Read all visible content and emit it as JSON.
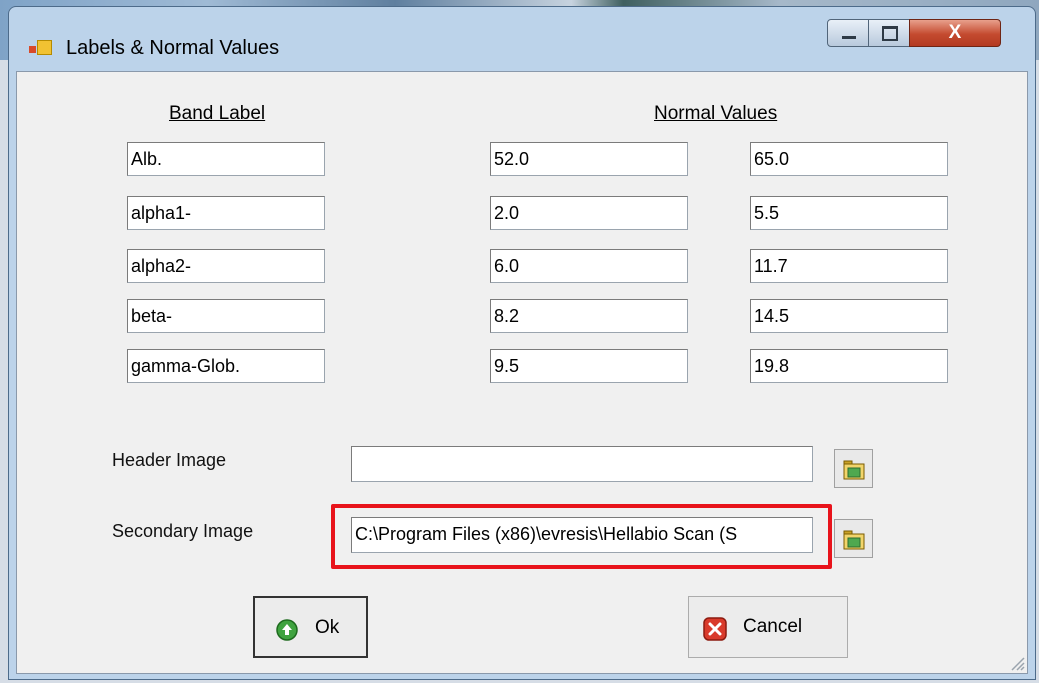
{
  "window": {
    "title": "Labels & Normal Values"
  },
  "titlebar": {
    "close_glyph": "X"
  },
  "headers": {
    "band_label": "Band Label",
    "normal_values": "Normal Values"
  },
  "bands": [
    {
      "label": "Alb.",
      "low": "52.0",
      "high": "65.0"
    },
    {
      "label": "alpha1-",
      "low": "2.0",
      "high": "5.5"
    },
    {
      "label": "alpha2-",
      "low": "6.0",
      "high": "11.7"
    },
    {
      "label": "beta-",
      "low": "8.2",
      "high": "14.5"
    },
    {
      "label": "gamma-Glob.",
      "low": "9.5",
      "high": "19.8"
    }
  ],
  "header_image": {
    "label": "Header Image",
    "value": ""
  },
  "secondary_image": {
    "label": "Secondary Image",
    "value": "C:\\Program Files (x86)\\evresis\\Hellabio Scan (S"
  },
  "buttons": {
    "ok": "Ok",
    "cancel": "Cancel"
  },
  "colors": {
    "highlight": "#e8131b",
    "ok_icon": "#3fa33f",
    "cancel_icon": "#d93a2b"
  },
  "icons": {
    "app": "app-icon",
    "browse": "folder-open-icon",
    "ok": "green-arrow-icon",
    "cancel": "red-x-icon"
  }
}
